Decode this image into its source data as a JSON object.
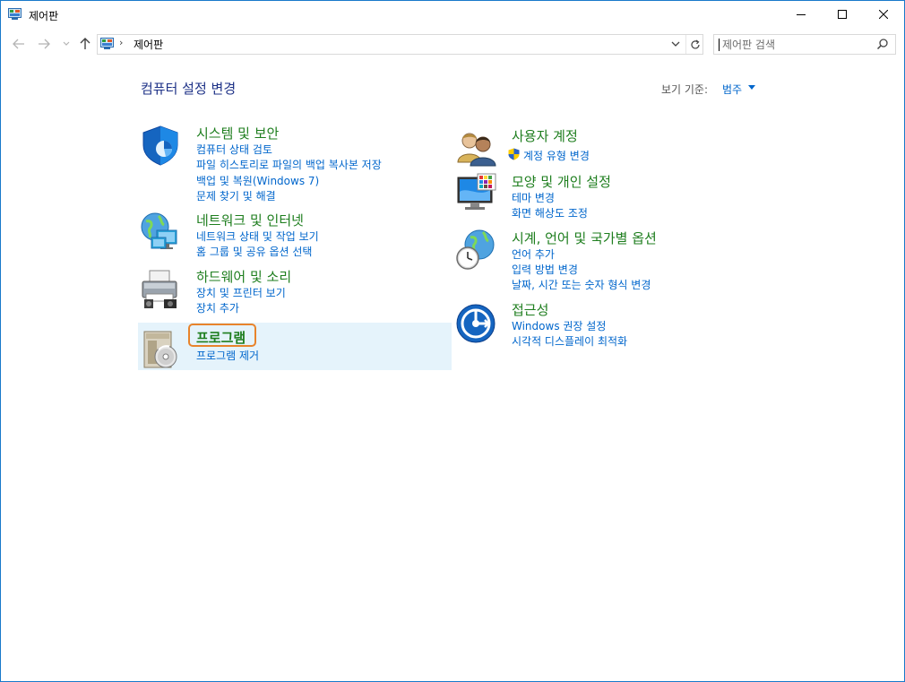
{
  "window": {
    "title": "제어판"
  },
  "address": {
    "path": "제어판",
    "separator": "›"
  },
  "search": {
    "placeholder": "제어판 검색"
  },
  "header": {
    "title": "컴퓨터 설정 변경",
    "view_by_label": "보기 기준:",
    "view_by_value": "범주"
  },
  "categories": [
    {
      "title": "시스템 및 보안",
      "icon": "shield-icon",
      "links": [
        "컴퓨터 상태 검토",
        "파일 히스토리로 파일의 백업 복사본 저장",
        "백업 및 복원(Windows 7)",
        "문제 찾기 및 해결"
      ]
    },
    {
      "title": "네트워크 및 인터넷",
      "icon": "network-globe-icon",
      "links": [
        "네트워크 상태 및 작업 보기",
        "홈 그룹 및 공유 옵션 선택"
      ]
    },
    {
      "title": "하드웨어 및 소리",
      "icon": "printer-speaker-icon",
      "links": [
        "장치 및 프린터 보기",
        "장치 추가"
      ]
    },
    {
      "title": "프로그램",
      "icon": "programs-disc-icon",
      "links": [
        "프로그램 제거"
      ]
    },
    {
      "title": "사용자 계정",
      "icon": "users-icon",
      "links": [
        "계정 유형 변경"
      ]
    },
    {
      "title": "모양 및 개인 설정",
      "icon": "monitor-palette-icon",
      "links": [
        "테마 변경",
        "화면 해상도 조정"
      ]
    },
    {
      "title": "시계, 언어 및 국가별 옵션",
      "icon": "clock-globe-icon",
      "links": [
        "언어 추가",
        "입력 방법 변경",
        "날짜, 시간 또는 숫자 형식 변경"
      ]
    },
    {
      "title": "접근성",
      "icon": "accessibility-icon",
      "links": [
        "Windows 권장 설정",
        "시각적 디스플레이 최적화"
      ]
    }
  ],
  "colors": {
    "title_green": "#1e7e1e",
    "link_blue": "#0066cc",
    "heading_navy": "#1e3287",
    "hover_bg": "#e5f3fb",
    "focus_orange": "#e8832b"
  }
}
